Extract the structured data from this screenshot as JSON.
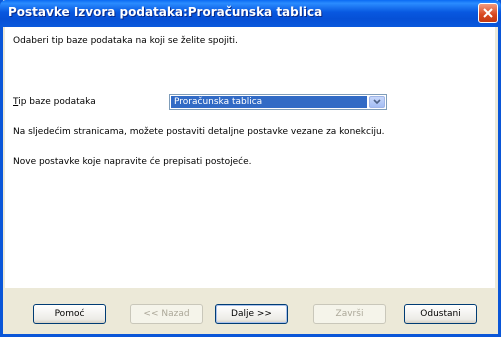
{
  "window": {
    "title": "Postavke Izvora podataka:Proračunska tablica"
  },
  "main": {
    "intro": "Odaberi tip baze podataka na koji se želite spojiti.",
    "db_type_label": "Tip baze podataka",
    "db_type_label_rest": "ip baze podataka",
    "db_type_label_key": "T",
    "db_type_value": "Proračunska tablica",
    "info_line1": "Na sljedećim stranicama, možete postaviti detaljne postavke vezane za konekciju.",
    "info_line2": "Nove postavke koje napravite će prepisati postojeće."
  },
  "buttons": {
    "help": "Pomoć",
    "back": "<< Nazad",
    "next": "Dalje >>",
    "finish": "Završi",
    "cancel": "Odustani"
  },
  "icons": {
    "close": "close-icon",
    "dropdown": "chevron-down-icon"
  },
  "colors": {
    "titlebar": "#0858e0",
    "selection": "#316ac5",
    "dialog_bg": "#ece9d8",
    "close": "#d8461f"
  }
}
